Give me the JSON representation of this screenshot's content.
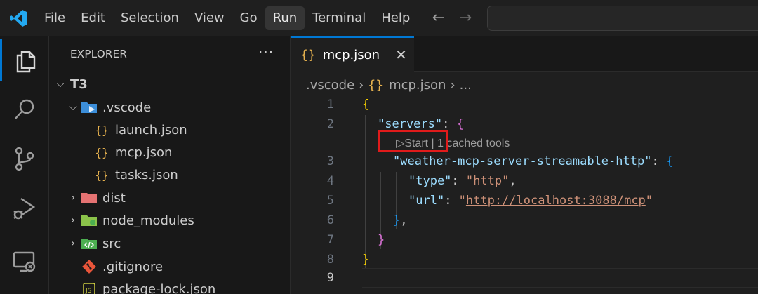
{
  "menu": {
    "items": [
      "File",
      "Edit",
      "Selection",
      "View",
      "Go",
      "Run",
      "Terminal",
      "Help"
    ],
    "active": "Run"
  },
  "nav": {
    "back": "←",
    "forward": "→"
  },
  "sidebar": {
    "title": "EXPLORER",
    "more": "···",
    "root": "T3",
    "items": [
      {
        "label": ".vscode",
        "type": "folder-open",
        "icon": "vscode-folder-icon"
      },
      {
        "label": "launch.json",
        "type": "file",
        "icon": "json-icon"
      },
      {
        "label": "mcp.json",
        "type": "file",
        "icon": "json-icon"
      },
      {
        "label": "tasks.json",
        "type": "file",
        "icon": "json-icon"
      },
      {
        "label": "dist",
        "type": "folder",
        "icon": "dist-folder-icon"
      },
      {
        "label": "node_modules",
        "type": "folder",
        "icon": "node-folder-icon"
      },
      {
        "label": "src",
        "type": "folder",
        "icon": "src-folder-icon"
      },
      {
        "label": ".gitignore",
        "type": "file",
        "icon": "git-icon"
      },
      {
        "label": "package-lock.json",
        "type": "file",
        "icon": "js-icon"
      }
    ]
  },
  "editor": {
    "tab": {
      "label": "mcp.json",
      "icon": "{}",
      "close": "✕"
    },
    "breadcrumb": {
      "folder": ".vscode",
      "file": "mcp.json",
      "more": "..."
    },
    "line_numbers": [
      "1",
      "2",
      "3",
      "4",
      "5",
      "6",
      "7",
      "8",
      "9"
    ],
    "codelens": "▷Start | 1 cached tools",
    "code": {
      "l1_open": "{",
      "l2_key": "\"servers\"",
      "l2_rest": ": ",
      "l2_brace": "{",
      "l3_key": "\"weather-mcp-server-streamable-http\"",
      "l3_rest": ": ",
      "l3_brace": "{",
      "l4_key": "\"type\"",
      "l4_sep": ": ",
      "l4_val": "\"http\"",
      "l4_comma": ",",
      "l5_key": "\"url\"",
      "l5_sep": ": ",
      "l5_q1": "\"",
      "l5_url": "http://localhost:3088/mcp",
      "l5_q2": "\"",
      "l6_close": "}",
      "l6_comma": ",",
      "l7_close": "}",
      "l8_close": "}"
    }
  },
  "colors": {
    "accent": "#0078d4",
    "highlight": "#e01b1b"
  }
}
